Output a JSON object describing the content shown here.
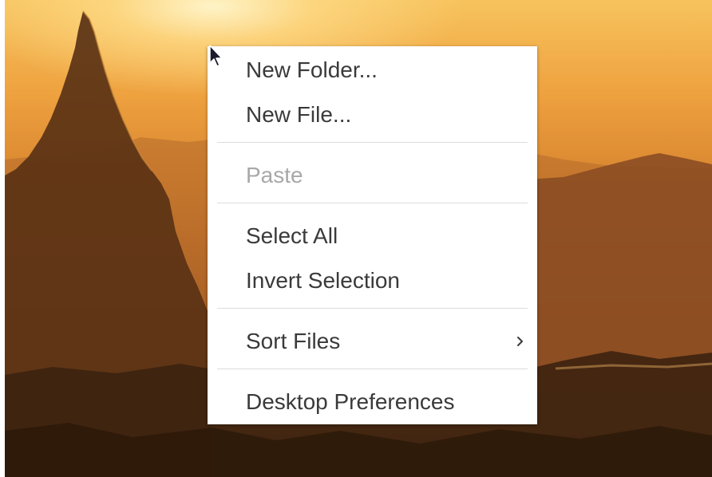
{
  "context_menu": {
    "items": [
      {
        "label": "New Folder...",
        "enabled": true
      },
      {
        "label": "New File...",
        "enabled": true
      },
      {
        "label": "Paste",
        "enabled": false
      },
      {
        "label": "Select All",
        "enabled": true
      },
      {
        "label": "Invert Selection",
        "enabled": true
      },
      {
        "label": "Sort Files",
        "enabled": true,
        "submenu_icon": "chevron-right-icon"
      },
      {
        "label": "Desktop Preferences",
        "enabled": true
      }
    ]
  },
  "cursor": {
    "icon": "mouse-pointer-icon"
  },
  "colors": {
    "menu_background": "#ffffff",
    "menu_text": "#3a3a3a",
    "menu_text_disabled": "#a8a8a8",
    "separator": "#dcdcdc"
  }
}
